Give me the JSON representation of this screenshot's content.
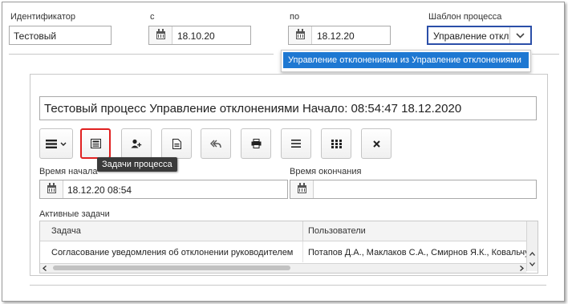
{
  "filters": {
    "id_label": "Идентификатор",
    "id_value": "Тестовый",
    "from_label": "с",
    "from_value": "18.10.20",
    "to_label": "по",
    "to_value": "18.12.20",
    "template_label": "Шаблон процесса",
    "template_value": "Управление отклонениями",
    "template_option": "Управление отклонениями из Управление отклонениями"
  },
  "process": {
    "title": "Тестовый процесс Управление отклонениями Начало: 08:54:47 18.12.2020",
    "tooltip": "Задачи процесса",
    "start_label": "Время начала",
    "start_value": "18.12.20 08:54",
    "end_label": "Время окончания",
    "end_value": "",
    "tasks_label": "Активные задачи",
    "columns": [
      "Задача",
      "Пользователи"
    ],
    "rows": [
      {
        "task": "Согласование уведомления об отклонении руководителем",
        "users": "Потапов Д.А., Маклаков С.А., Смирнов Я.К., Ковальчук"
      }
    ]
  },
  "colors": {
    "accent": "#1e78d2",
    "highlight_border": "#e02020",
    "tooltip_bg": "#3a3a3a"
  },
  "icons": [
    "menu-dropdown-icon",
    "tasks-list-icon",
    "add-user-icon",
    "document-icon",
    "reply-icon",
    "print-icon",
    "list-icon",
    "grid-icon",
    "close-icon",
    "calendar-icon",
    "chevron-down-icon"
  ]
}
